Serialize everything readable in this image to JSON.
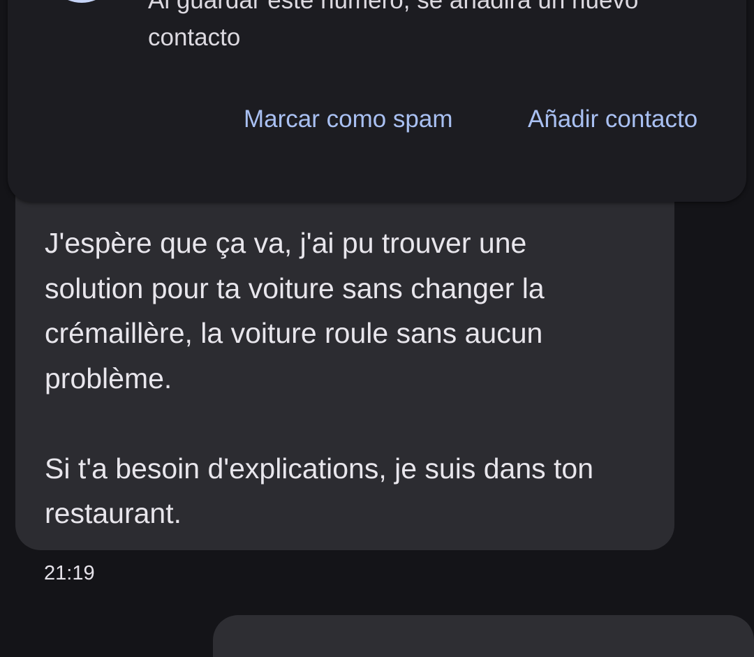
{
  "unknown_sender_card": {
    "notice": "Al guardar este número, se añadirá un nuevo contacto",
    "report_spam_label": "Marcar como spam",
    "add_contact_label": "Añadir contacto",
    "avatar_icon": "person-icon"
  },
  "message": {
    "text": "J'espère que ça va, j'ai pu trouver une\nsolution pour ta voiture sans changer la\ncrémaillère, la voiture roule sans aucun\nproblème.\n\nSi t'a besoin d'explications, je suis dans ton\nrestaurant.",
    "timestamp": "21:19"
  },
  "colors": {
    "background": "#141418",
    "bubble": "#2c2c31",
    "card": "#1c1c21",
    "accent_text": "#a9c0f2",
    "avatar": "#c6d4f7"
  }
}
